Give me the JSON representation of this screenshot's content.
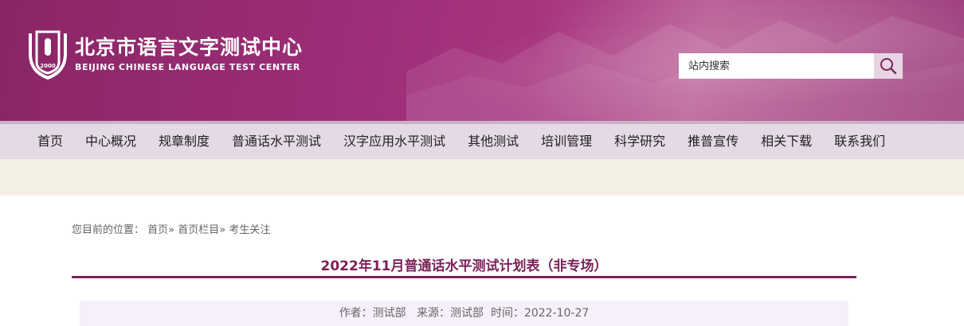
{
  "header": {
    "title_cn": "北京市语言文字测试中心",
    "title_en": "BEIJING CHINESE LANGUAGE TEST CENTER",
    "emblem_text": "2000",
    "brand_color": "#9c2d78"
  },
  "search": {
    "placeholder": "站内搜索",
    "icon": "search-icon"
  },
  "nav": {
    "items": [
      {
        "label": "首页"
      },
      {
        "label": "中心概况"
      },
      {
        "label": "规章制度"
      },
      {
        "label": "普通话水平测试"
      },
      {
        "label": "汉字应用水平测试"
      },
      {
        "label": "其他测试"
      },
      {
        "label": "培训管理"
      },
      {
        "label": "科学研究"
      },
      {
        "label": "推普宣传"
      },
      {
        "label": "相关下载"
      },
      {
        "label": "联系我们"
      }
    ]
  },
  "breadcrumb": {
    "prefix": "您目前的位置：",
    "home": "首页",
    "sep1": "»",
    "section": "首页栏目",
    "sep2": "»",
    "current": "考生关注"
  },
  "article": {
    "title": "2022年11月普通话水平测试计划表（非专场）",
    "meta": "作者：测试部   来源：测试部  时间：2022-10-27"
  }
}
